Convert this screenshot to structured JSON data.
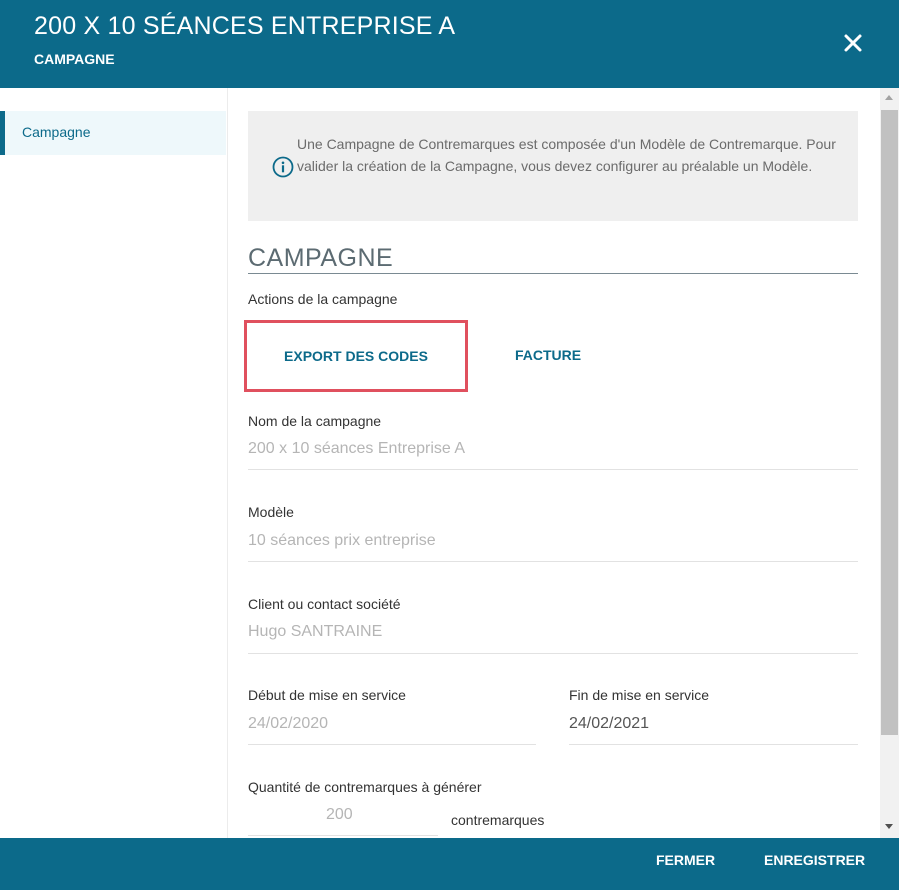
{
  "header": {
    "title": "200 X 10 SÉANCES ENTREPRISE A",
    "subtitle": "CAMPAGNE"
  },
  "sidebar": {
    "items": [
      {
        "label": "Campagne"
      }
    ]
  },
  "info": {
    "text": "Une Campagne de Contremarques est composée d'un Modèle de Contremarque. Pour valider la création de la Campagne, vous devez configurer au préalable un Modèle."
  },
  "section": {
    "title": "CAMPAGNE",
    "actions_label": "Actions de la campagne",
    "export_label": "EXPORT DES CODES",
    "facture_label": "FACTURE"
  },
  "fields": {
    "nom": {
      "label": "Nom de la campagne",
      "value": "200 x 10 séances Entreprise A"
    },
    "modele": {
      "label": "Modèle",
      "value": "10 séances prix entreprise"
    },
    "client": {
      "label": "Client ou contact société",
      "value": "Hugo SANTRAINE"
    },
    "debut": {
      "label": "Début de mise en service",
      "value": "24/02/2020"
    },
    "fin": {
      "label": "Fin de mise en service",
      "value": "24/02/2021"
    },
    "quantite": {
      "label": "Quantité de contremarques à générer",
      "value": "200",
      "unit": "contremarques"
    }
  },
  "footer": {
    "close_label": "FERMER",
    "save_label": "ENREGISTRER"
  },
  "colors": {
    "primary": "#0c6a8a",
    "highlight": "#e0505e"
  }
}
